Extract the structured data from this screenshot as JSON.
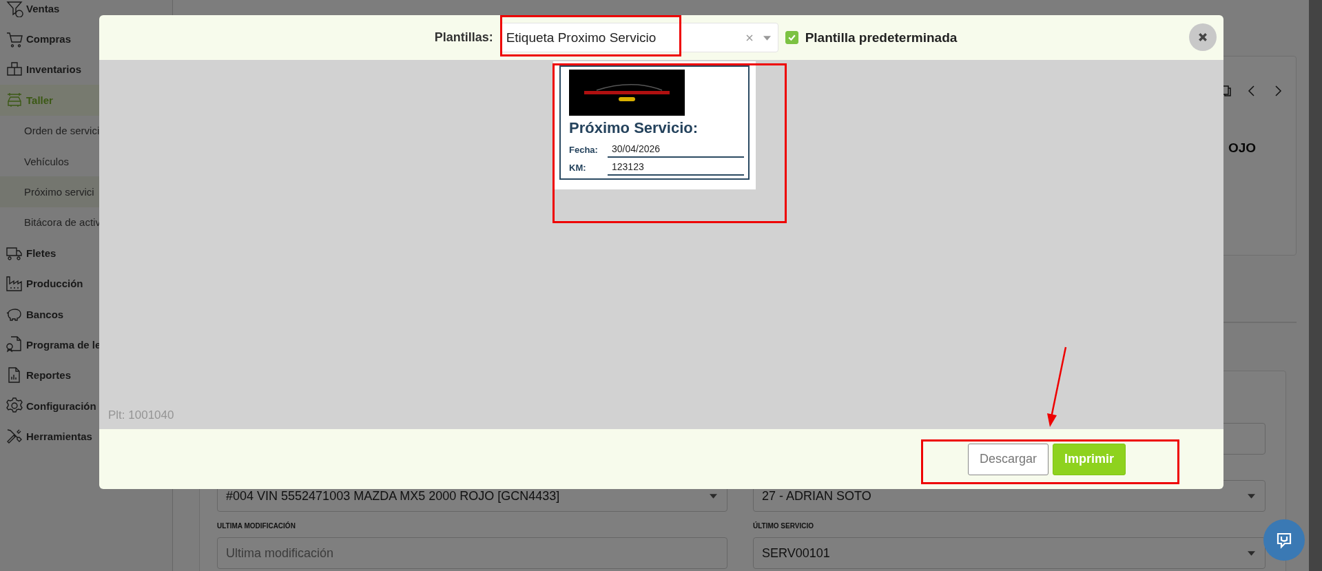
{
  "sidebar": {
    "items": [
      {
        "label": "Ventas",
        "selected": false
      },
      {
        "label": "Compras",
        "selected": false
      },
      {
        "label": "Inventarios",
        "selected": false
      },
      {
        "label": "Taller",
        "selected": true,
        "children": [
          {
            "label": "Orden de servici",
            "selected": false
          },
          {
            "label": "Vehículos",
            "selected": false
          },
          {
            "label": "Próximo servici",
            "selected": true
          },
          {
            "label": "Bitácora de activ",
            "selected": false
          }
        ]
      },
      {
        "label": "Fletes",
        "selected": false
      },
      {
        "label": "Producción",
        "selected": false
      },
      {
        "label": "Bancos",
        "selected": false
      },
      {
        "label": "Programa de le",
        "selected": false
      },
      {
        "label": "Reportes",
        "selected": false
      },
      {
        "label": "Configuración",
        "selected": false
      },
      {
        "label": "Herramientas",
        "selected": false
      }
    ]
  },
  "record_card": {
    "text": "OJO"
  },
  "form": {
    "fields": [
      {
        "kind": "input"
      },
      {
        "kind": "select",
        "value": "#004 VIN 5552471003 MAZDA MX5 2000 ROJO [GCN4433]"
      },
      {
        "kind": "select",
        "value": "27 - ADRIAN SOTO"
      },
      {
        "kind": "input",
        "label": "ULTIMA MODIFICACIÓN",
        "placeholder": "Ultima modificación"
      },
      {
        "kind": "select",
        "label": "ÚLTIMO SERVICIO",
        "value": "SERV00101"
      }
    ]
  },
  "modal": {
    "template_label": "Plantillas:",
    "template_value": "Etiqueta Proximo Servicio",
    "default_checkbox": {
      "label": "Plantilla predeterminada",
      "checked": true
    },
    "preview": {
      "title": "Próximo Servicio:",
      "rows": [
        {
          "label": "Fecha:",
          "value": "30/04/2026"
        },
        {
          "label": "KM:",
          "value": "123123"
        }
      ]
    },
    "template_id": "Plt: 1001040",
    "buttons": [
      {
        "label": "Descargar",
        "kind": "secondary"
      },
      {
        "label": "Imprimir",
        "kind": "primary"
      }
    ]
  }
}
